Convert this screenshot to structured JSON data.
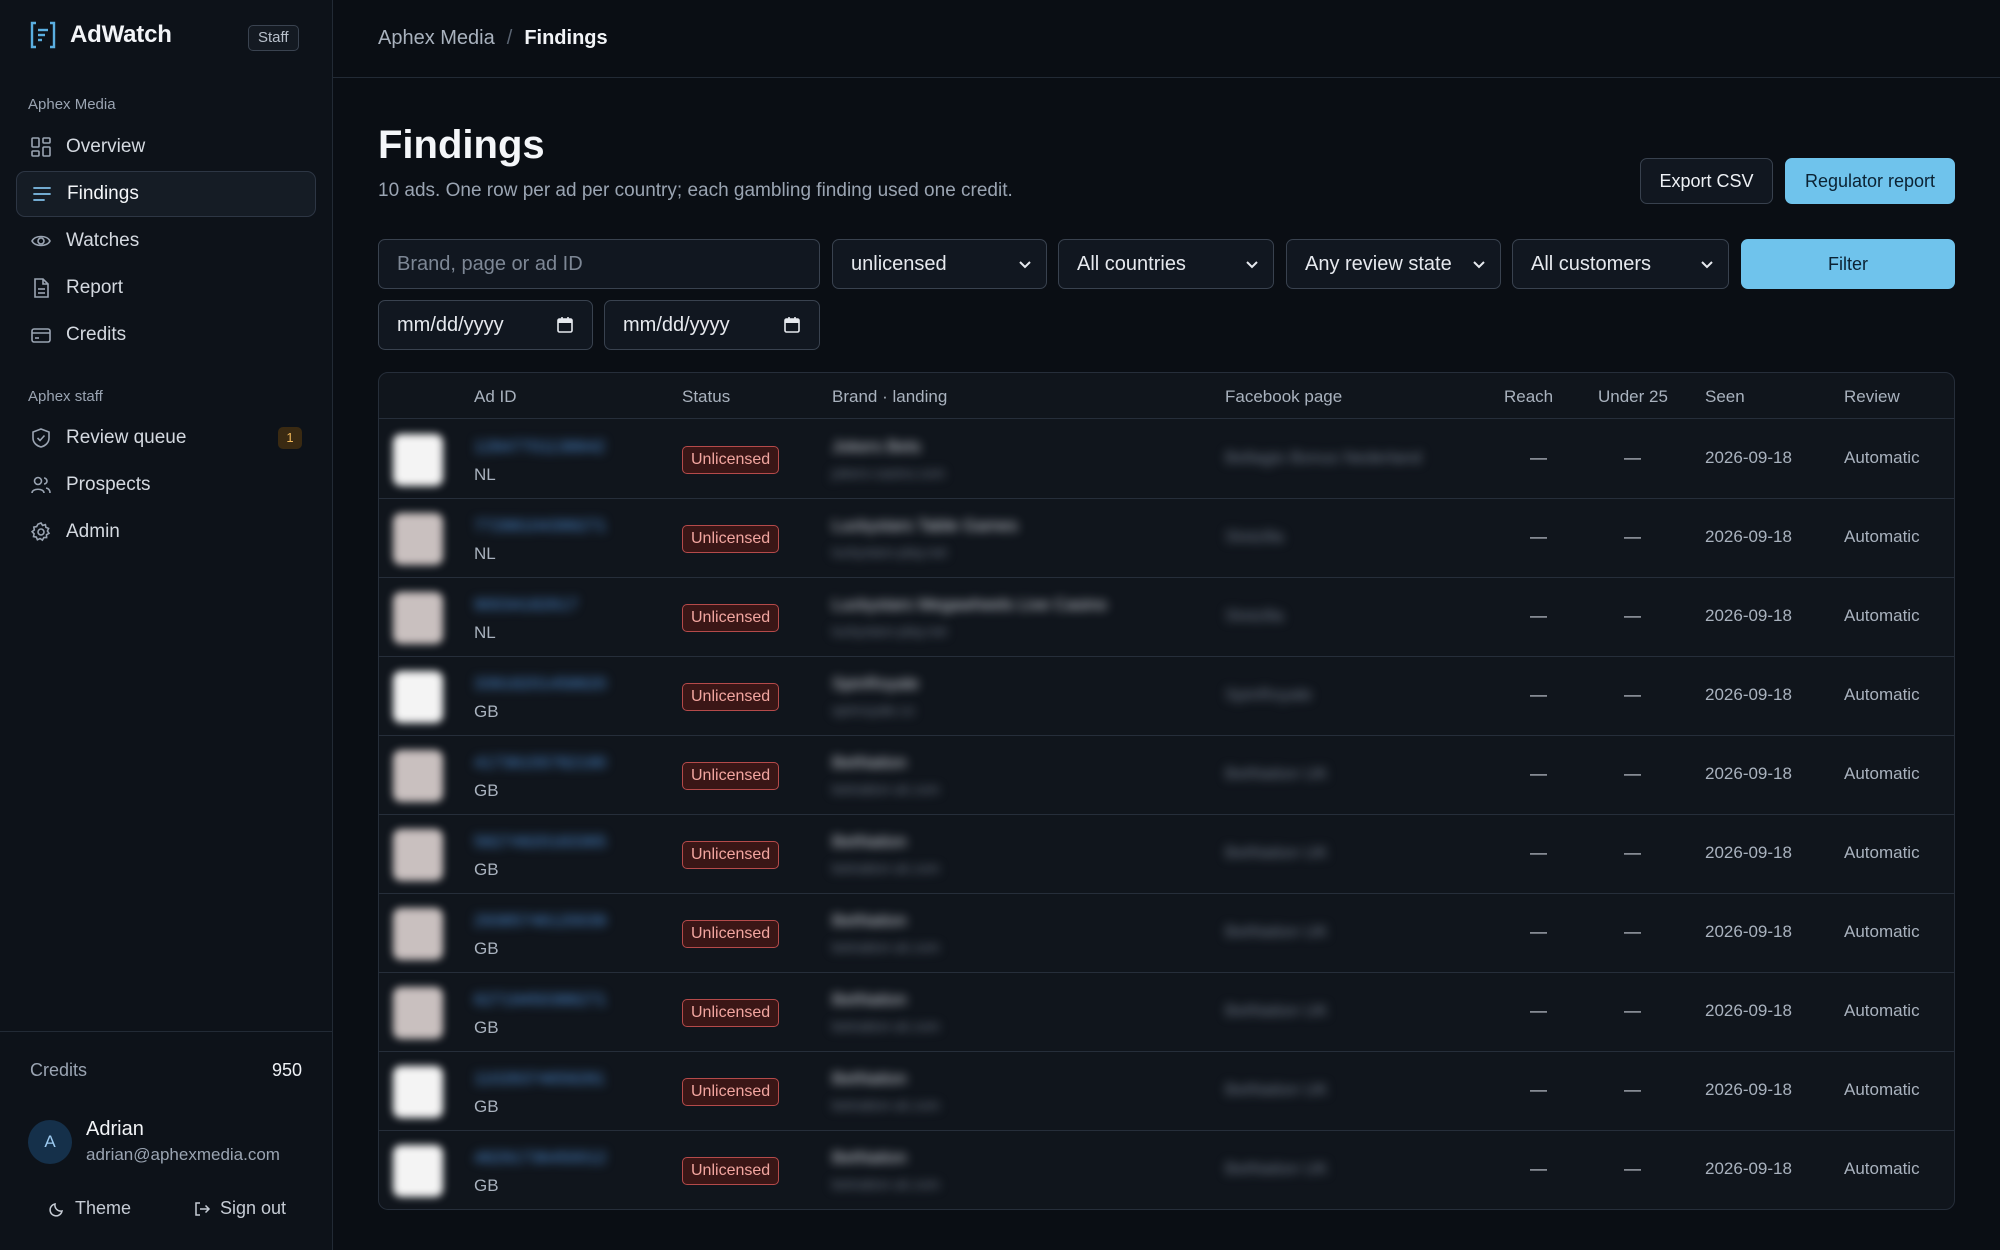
{
  "app": {
    "name": "AdWatch",
    "staff_badge": "Staff"
  },
  "sidebar": {
    "org_section": "Aphex Media",
    "org_items": [
      {
        "label": "Overview",
        "icon": "grid-icon"
      },
      {
        "label": "Findings",
        "icon": "lines-icon",
        "active": true
      },
      {
        "label": "Watches",
        "icon": "eye-icon"
      },
      {
        "label": "Report",
        "icon": "document-icon"
      },
      {
        "label": "Credits",
        "icon": "card-icon"
      }
    ],
    "staff_section": "Aphex staff",
    "staff_items": [
      {
        "label": "Review queue",
        "icon": "shield-check-icon",
        "badge": "1"
      },
      {
        "label": "Prospects",
        "icon": "users-icon"
      },
      {
        "label": "Admin",
        "icon": "gear-icon"
      }
    ],
    "credits_label": "Credits",
    "credits_value": "950",
    "user": {
      "initial": "A",
      "name": "Adrian",
      "email": "adrian@aphexmedia.com"
    },
    "theme_label": "Theme",
    "signout_label": "Sign out"
  },
  "breadcrumb": {
    "parent": "Aphex Media",
    "separator": "/",
    "current": "Findings"
  },
  "header": {
    "title": "Findings",
    "subtitle": "10 ads. One row per ad per country; each gambling finding used one credit.",
    "export_label": "Export CSV",
    "report_label": "Regulator report"
  },
  "filters": {
    "search_placeholder": "Brand, page or ad ID",
    "status_value": "unlicensed",
    "country_value": "All countries",
    "review_value": "Any review state",
    "customer_value": "All customers",
    "filter_label": "Filter",
    "date_from": "mm/dd/yyyy",
    "date_to": "mm/dd/yyyy"
  },
  "table": {
    "columns": {
      "ad_id": "Ad ID",
      "status": "Status",
      "brand": "Brand · landing",
      "page": "Facebook page",
      "reach": "Reach",
      "under25": "Under 25",
      "seen": "Seen",
      "review": "Review"
    },
    "rows": [
      {
        "ad_id": "12847701138842",
        "country": "NL",
        "status": "Unlicensed",
        "brand": "Jokers Bets",
        "landing": "jokers-casino.com",
        "page": "Bellagio Bonus Nederland",
        "reach": "—",
        "under25": "—",
        "seen": "2026-09-18",
        "review": "Automatic",
        "thumb": "white"
      },
      {
        "ad_id": "77288104399271",
        "country": "NL",
        "status": "Unlicensed",
        "brand": "Luckystars Table Games",
        "landing": "luckystars-play.net",
        "page": "Slotzilla",
        "reach": "—",
        "under25": "—",
        "seen": "2026-09-18",
        "review": "Automatic",
        "thumb": "gray"
      },
      {
        "ad_id": "90034182617",
        "country": "NL",
        "status": "Unlicensed",
        "brand": "Luckystars Megawheels Live Casino",
        "landing": "luckystars-play.net",
        "page": "Slotzilla",
        "reach": "—",
        "under25": "—",
        "seen": "2026-09-18",
        "review": "Automatic",
        "thumb": "gray"
      },
      {
        "ad_id": "33918201458820",
        "country": "GB",
        "status": "Unlicensed",
        "brand": "SpinRoyale",
        "landing": "spinroyale.co",
        "page": "SpinRoyale",
        "reach": "—",
        "under25": "—",
        "seen": "2026-09-18",
        "review": "Automatic",
        "thumb": "white"
      },
      {
        "ad_id": "41736155782190",
        "country": "GB",
        "status": "Unlicensed",
        "brand": "BetNation",
        "landing": "betnation-uk.com",
        "page": "BetNation UK",
        "reach": "—",
        "under25": "—",
        "seen": "2026-09-18",
        "review": "Automatic",
        "thumb": "gray"
      },
      {
        "ad_id": "58274920183365",
        "country": "GB",
        "status": "Unlicensed",
        "brand": "BetNation",
        "landing": "betnation-uk.com",
        "page": "BetNation UK",
        "reach": "—",
        "under25": "—",
        "seen": "2026-09-18",
        "review": "Automatic",
        "thumb": "gray"
      },
      {
        "ad_id": "29385746120039",
        "country": "GB",
        "status": "Unlicensed",
        "brand": "BetNation",
        "landing": "betnation-uk.com",
        "page": "BetNation UK",
        "reach": "—",
        "under25": "—",
        "seen": "2026-09-18",
        "review": "Automatic",
        "thumb": "gray"
      },
      {
        "ad_id": "62719450388271",
        "country": "GB",
        "status": "Unlicensed",
        "brand": "BetNation",
        "landing": "betnation-uk.com",
        "page": "BetNation UK",
        "reach": "—",
        "under25": "—",
        "seen": "2026-09-18",
        "review": "Automatic",
        "thumb": "gray"
      },
      {
        "ad_id": "11028374659281",
        "country": "GB",
        "status": "Unlicensed",
        "brand": "BetNation",
        "landing": "betnation-uk.com",
        "page": "BetNation UK",
        "reach": "—",
        "under25": "—",
        "seen": "2026-09-18",
        "review": "Automatic",
        "thumb": "white"
      },
      {
        "ad_id": "48291736450012",
        "country": "GB",
        "status": "Unlicensed",
        "brand": "BetNation",
        "landing": "betnation-uk.com",
        "page": "BetNation UK",
        "reach": "—",
        "under25": "—",
        "seen": "2026-09-18",
        "review": "Automatic",
        "thumb": "white"
      }
    ]
  },
  "colors": {
    "accent": "#6fc3ec",
    "danger": "#b54a4a",
    "background": "#0a0e14"
  }
}
